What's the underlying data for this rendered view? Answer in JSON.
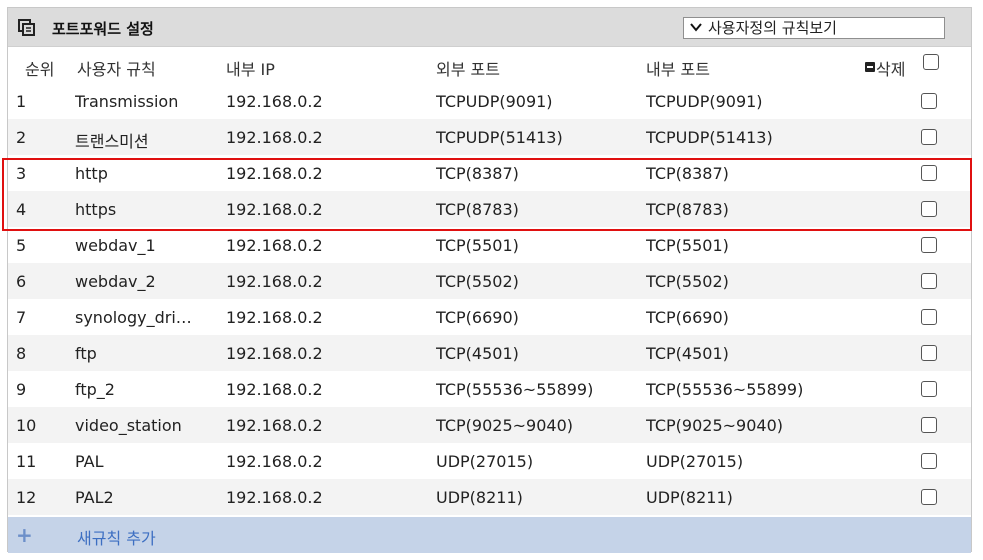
{
  "panel": {
    "title": "포트포워드 설정",
    "rule_select": "사용자정의 규칙보기"
  },
  "columns": {
    "order": "순위",
    "rule": "사용자 규칙",
    "internal_ip": "내부 IP",
    "external_port": "외부 포트",
    "internal_port": "내부 포트",
    "delete": "삭제"
  },
  "rows": [
    {
      "num": "1",
      "name": "Transmission",
      "ip": "192.168.0.2",
      "ext": "TCPUDP(9091)",
      "int": "TCPUDP(9091)"
    },
    {
      "num": "2",
      "name": "트랜스미션",
      "ip": "192.168.0.2",
      "ext": "TCPUDP(51413)",
      "int": "TCPUDP(51413)"
    },
    {
      "num": "3",
      "name": "http",
      "ip": "192.168.0.2",
      "ext": "TCP(8387)",
      "int": "TCP(8387)"
    },
    {
      "num": "4",
      "name": "https",
      "ip": "192.168.0.2",
      "ext": "TCP(8783)",
      "int": "TCP(8783)"
    },
    {
      "num": "5",
      "name": "webdav_1",
      "ip": "192.168.0.2",
      "ext": "TCP(5501)",
      "int": "TCP(5501)"
    },
    {
      "num": "6",
      "name": "webdav_2",
      "ip": "192.168.0.2",
      "ext": "TCP(5502)",
      "int": "TCP(5502)"
    },
    {
      "num": "7",
      "name": "synology_dri…",
      "ip": "192.168.0.2",
      "ext": "TCP(6690)",
      "int": "TCP(6690)"
    },
    {
      "num": "8",
      "name": "ftp",
      "ip": "192.168.0.2",
      "ext": "TCP(4501)",
      "int": "TCP(4501)"
    },
    {
      "num": "9",
      "name": "ftp_2",
      "ip": "192.168.0.2",
      "ext": "TCP(55536~55899)",
      "int": "TCP(55536~55899)"
    },
    {
      "num": "10",
      "name": "video_station",
      "ip": "192.168.0.2",
      "ext": "TCP(9025~9040)",
      "int": "TCP(9025~9040)"
    },
    {
      "num": "11",
      "name": "PAL",
      "ip": "192.168.0.2",
      "ext": "UDP(27015)",
      "int": "UDP(27015)"
    },
    {
      "num": "12",
      "name": "PAL2",
      "ip": "192.168.0.2",
      "ext": "UDP(8211)",
      "int": "UDP(8211)"
    }
  ],
  "add_row": {
    "plus": "+",
    "label": "새규칙 추가"
  },
  "colors": {
    "highlight": "#e01010",
    "add_row_bg": "#c5d3e8",
    "add_label": "#3d6fc2"
  }
}
